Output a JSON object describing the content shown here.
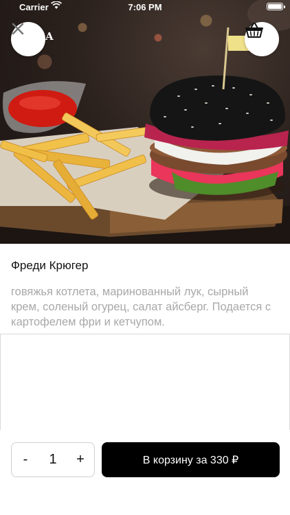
{
  "status_bar": {
    "carrier": "Carrier",
    "time": "7:06 PM"
  },
  "header": {
    "close_icon": "close-icon",
    "cart_icon": "basket-icon",
    "brand_text": "A"
  },
  "product": {
    "image_alt": "burger-with-fries-photo",
    "name": "Фреди Крюгер",
    "description": "говяжья котлета, маринованный лук, сырный крем, соленый огурец, салат айсберг. Подается с картофелем фри и кетчупом."
  },
  "order": {
    "minus_label": "-",
    "quantity": "1",
    "plus_label": "+",
    "add_to_cart_label": "В корзину за 330 ₽"
  },
  "colors": {
    "primary_button": "#000000",
    "description_text": "#a8a8a8",
    "divider": "#d8d8d8"
  }
}
